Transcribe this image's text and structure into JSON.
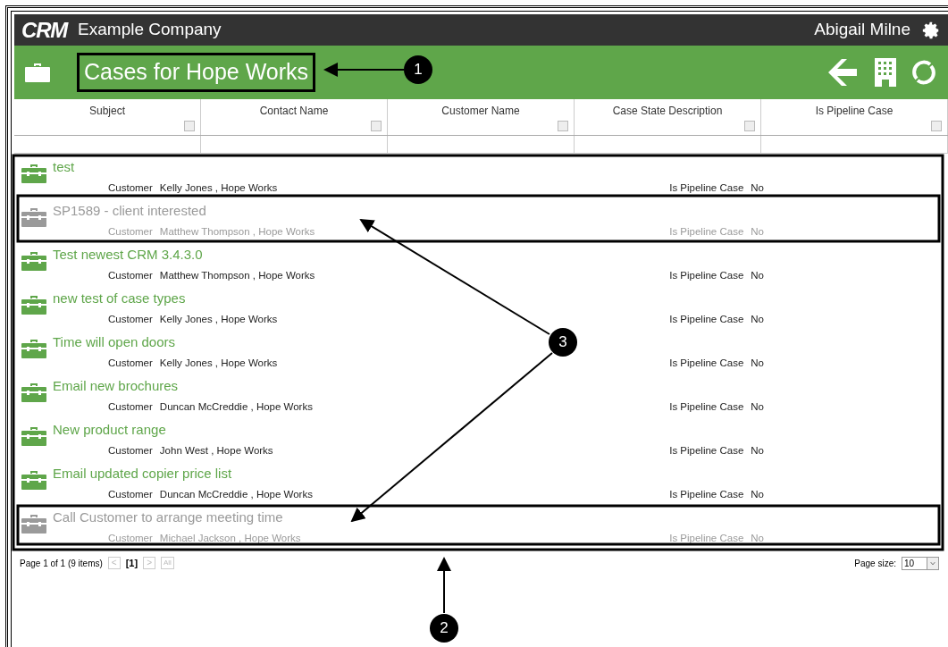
{
  "top_bar": {
    "logo": "CRM",
    "company": "Example Company",
    "user": "Abigail Milne"
  },
  "page_title": "Cases for Hope Works",
  "table": {
    "columns": [
      {
        "label": "Subject"
      },
      {
        "label": "Contact Name"
      },
      {
        "label": "Customer Name"
      },
      {
        "label": "Case State Description"
      },
      {
        "label": "Is Pipeline Case"
      }
    ],
    "rows": [
      {
        "subject": "test",
        "customer_label": "Customer",
        "customer": "Kelly Jones , Hope Works",
        "pipeline_label": "Is Pipeline Case",
        "pipeline": "No",
        "inactive": false
      },
      {
        "subject": "SP1589 - client interested",
        "customer_label": "Customer",
        "customer": "Matthew Thompson , Hope Works",
        "pipeline_label": "Is Pipeline Case",
        "pipeline": "No",
        "inactive": true
      },
      {
        "subject": "Test newest CRM 3.4.3.0",
        "customer_label": "Customer",
        "customer": "Matthew Thompson , Hope Works",
        "pipeline_label": "Is Pipeline Case",
        "pipeline": "No",
        "inactive": false
      },
      {
        "subject": "new test of case types",
        "customer_label": "Customer",
        "customer": "Kelly Jones , Hope Works",
        "pipeline_label": "Is Pipeline Case",
        "pipeline": "No",
        "inactive": false
      },
      {
        "subject": "Time will open doors",
        "customer_label": "Customer",
        "customer": "Kelly Jones , Hope Works",
        "pipeline_label": "Is Pipeline Case",
        "pipeline": "No",
        "inactive": false
      },
      {
        "subject": "Email new brochures",
        "customer_label": "Customer",
        "customer": "Duncan McCreddie , Hope Works",
        "pipeline_label": "Is Pipeline Case",
        "pipeline": "No",
        "inactive": false
      },
      {
        "subject": "New product range",
        "customer_label": "Customer",
        "customer": "John West , Hope Works",
        "pipeline_label": "Is Pipeline Case",
        "pipeline": "No",
        "inactive": false
      },
      {
        "subject": "Email updated copier price list",
        "customer_label": "Customer",
        "customer": "Duncan McCreddie , Hope Works",
        "pipeline_label": "Is Pipeline Case",
        "pipeline": "No",
        "inactive": false
      },
      {
        "subject": "Call Customer to arrange meeting time",
        "customer_label": "Customer",
        "customer": "Michael Jackson , Hope Works",
        "pipeline_label": "Is Pipeline Case",
        "pipeline": "No",
        "inactive": true
      }
    ]
  },
  "pager": {
    "summary": "Page 1 of 1 (9 items)",
    "prev": "<",
    "current": "[1]",
    "next": ">",
    "all": "All",
    "page_size_label": "Page size:",
    "page_size": "10"
  },
  "callouts": [
    {
      "number": "1"
    },
    {
      "number": "2"
    },
    {
      "number": "3"
    }
  ]
}
